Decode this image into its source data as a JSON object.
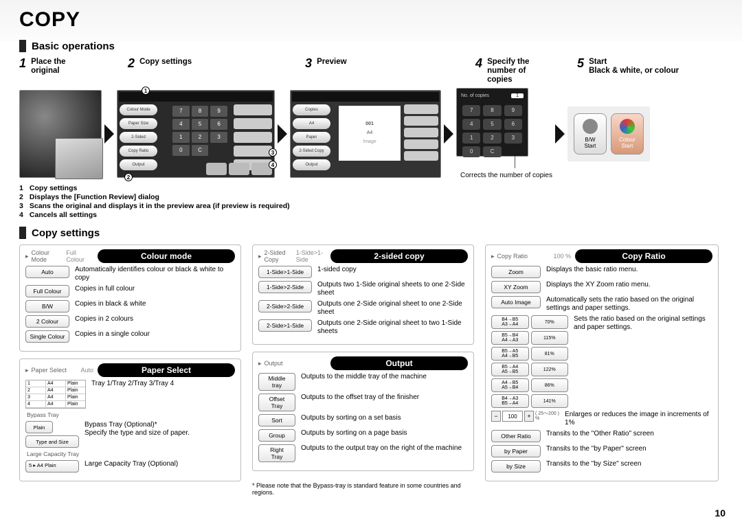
{
  "page_title": "COPY",
  "page_number": "10",
  "sections": {
    "basic_ops": "Basic operations",
    "copy_settings": "Copy settings"
  },
  "steps": {
    "s1": {
      "num": "1",
      "label": "Place the\noriginal"
    },
    "s2": {
      "num": "2",
      "label": "Copy settings"
    },
    "s3": {
      "num": "3",
      "label": "Preview"
    },
    "s4": {
      "num": "4",
      "label": "Specify the\nnumber of\ncopies"
    },
    "s5": {
      "num": "5",
      "label": "Start\nBlack & white, or colour"
    }
  },
  "s2_sidebar": [
    "Colour Mode",
    "Paper Size",
    "2-Sided",
    "Copy Ratio",
    "Output"
  ],
  "s2_keypad": [
    "7",
    "8",
    "9",
    "4",
    "5",
    "6",
    "1",
    "2",
    "3",
    "0",
    "C"
  ],
  "s2_notes": [
    "Copy settings",
    "Displays the [Function Review] dialog",
    "Scans the original and displays it in the preview area (if preview is required)",
    "Cancels all settings"
  ],
  "s3_sidebar": [
    "Copies",
    "A4",
    "Paper",
    "2-Sided Copy",
    "Output"
  ],
  "s3_preview": {
    "code": "001",
    "size": "A4",
    "label": "Image"
  },
  "s4": {
    "header": "No. of copies",
    "header_val": "1",
    "keys": [
      "7",
      "8",
      "9",
      "4",
      "5",
      "6",
      "1",
      "2",
      "3",
      "0",
      "C"
    ],
    "note": "Corrects the number of copies"
  },
  "s5_btns": {
    "bw": "B/W\nStart",
    "colour": "Colour\nStart"
  },
  "panels": {
    "colour_mode": {
      "icon_label": "Colour Mode",
      "icon_right": "Full Colour",
      "title": "Colour mode",
      "rows": [
        {
          "btn": "Auto",
          "desc": "Automatically identifies colour or black & white to copy"
        },
        {
          "btn": "Full Colour",
          "desc": "Copies in full colour"
        },
        {
          "btn": "B/W",
          "desc": "Copies in black & white"
        },
        {
          "btn": "2 Colour",
          "desc": "Copies in 2 colours"
        },
        {
          "btn": "Single Colour",
          "desc": "Copies in a single colour"
        }
      ]
    },
    "paper_select": {
      "icon_label": "Paper Select",
      "icon_right": "Auto",
      "title": "Paper Select",
      "tray_table": [
        [
          "1",
          "A4",
          "Plain"
        ],
        [
          "2",
          "A4",
          "Plain"
        ],
        [
          "3",
          "A4",
          "Plain"
        ],
        [
          "4",
          "A4",
          "Plain"
        ]
      ],
      "rows": [
        {
          "desc": "Tray 1/Tray 2/Tray 3/Tray 4"
        }
      ],
      "bypass": {
        "label": "Bypass Tray",
        "desc": "Bypass Tray (Optional)*\nSpecify the type and size of paper.",
        "sub1": "Plain",
        "sub2": "Type and Size"
      },
      "large": {
        "label": "Large Capacity Tray",
        "sub": "A4  Plain",
        "num": "5",
        "desc": "Large Capacity Tray (Optional)"
      }
    },
    "two_sided": {
      "icon_label": "2-Sided Copy",
      "icon_right": "1-Side>1-Side",
      "title": "2-sided copy",
      "rows": [
        {
          "btn": "1-Side>1-Side",
          "desc": "1-sided copy"
        },
        {
          "btn": "1-Side>2-Side",
          "desc": "Outputs two 1-Side original sheets to one 2-Side sheet"
        },
        {
          "btn": "2-Side>2-Side",
          "desc": "Outputs one 2-Side original sheet to one 2-Side sheet"
        },
        {
          "btn": "2-Side>1-Side",
          "desc": "Outputs one 2-Side original sheet to two 1-Side sheets"
        }
      ]
    },
    "output": {
      "icon_label": "Output",
      "title": "Output",
      "rows": [
        {
          "btn": "Middle\ntray",
          "desc": "Outputs to the middle tray of the machine"
        },
        {
          "btn": "Offset\nTray",
          "desc": "Outputs to the offset tray of the finisher"
        },
        {
          "btn": "Sort",
          "desc": "Outputs by sorting on a set basis"
        },
        {
          "btn": "Group",
          "desc": "Outputs by sorting on a page basis"
        },
        {
          "btn": "Right\nTray",
          "desc": "Outputs to the output tray on the right of the machine"
        }
      ],
      "footnote": "* Please note that the Bypass-tray is standard feature in some countries and regions."
    },
    "copy_ratio": {
      "icon_label": "Copy Ratio",
      "icon_right": "100 %",
      "title": "Copy Ratio",
      "rows": [
        {
          "btn": "Zoom",
          "desc": "Displays the basic ratio menu."
        },
        {
          "btn": "XY Zoom",
          "desc": "Displays the XY Zoom ratio menu."
        },
        {
          "btn": "Auto Image",
          "desc": "Automatically sets the ratio based on the original settings and paper settings."
        }
      ],
      "preset_grid": [
        "B4→B5\nA3→A4",
        "70%",
        "B5→B4\nA4→A3",
        "115%",
        "B5→A5\nA4→B5",
        "81%",
        "B5→A4\nA5→B5",
        "122%",
        "A4→B5\nA5→B4",
        "86%",
        "B4→A3\nB5→A4",
        "141%"
      ],
      "preset_desc": "Sets the ratio based on the original settings and paper settings.",
      "ratio_input": {
        "value": "100",
        "range": "( 25～200 )\n%",
        "desc": "Enlarges or reduces the image in increments of 1%"
      },
      "other": [
        {
          "btn": "Other Ratio",
          "desc": "Transits to the \"Other Ratio\" screen"
        },
        {
          "btn": "by Paper",
          "desc": "Transits to the \"by Paper\" screen"
        },
        {
          "btn": "by Size",
          "desc": "Transits to the \"by Size\" screen"
        }
      ]
    }
  }
}
